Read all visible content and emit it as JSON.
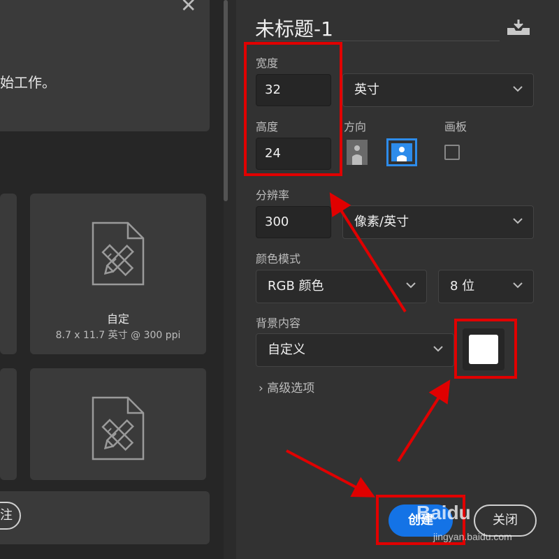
{
  "left": {
    "banner_text": "始工作。",
    "close_glyph": "✕",
    "cards": [
      {
        "title": "自定",
        "subtitle": "8.7 x 11.7 英寸 @ 300 ppi",
        "icon": "document-ruler-pencil-icon"
      },
      {
        "title": "",
        "subtitle": "",
        "icon": "document-ruler-pencil-icon"
      }
    ],
    "bottom_button_label": "注"
  },
  "panel": {
    "doc_title": "未标题-1",
    "save_preset_icon": "download-tray-icon",
    "width": {
      "label": "宽度",
      "value": "32"
    },
    "height": {
      "label": "高度",
      "value": "24"
    },
    "unit": {
      "value": "英寸"
    },
    "orientation": {
      "label": "方向",
      "selected": "landscape"
    },
    "artboard": {
      "label": "画板",
      "checked": false
    },
    "resolution": {
      "label": "分辨率",
      "value": "300",
      "unit": "像素/英寸"
    },
    "color_mode": {
      "label": "颜色模式",
      "mode": "RGB 颜色",
      "depth": "8 位"
    },
    "background": {
      "label": "背景内容",
      "value": "自定义",
      "swatch_color": "#ffffff"
    },
    "advanced_label": "高级选项",
    "create_label": "创建",
    "close_label": "关闭"
  },
  "colors": {
    "accent": "#1473e6",
    "annotation": "#e00000"
  },
  "watermark": {
    "logo": "Baidu",
    "url": "jingyan.baidu.com"
  }
}
